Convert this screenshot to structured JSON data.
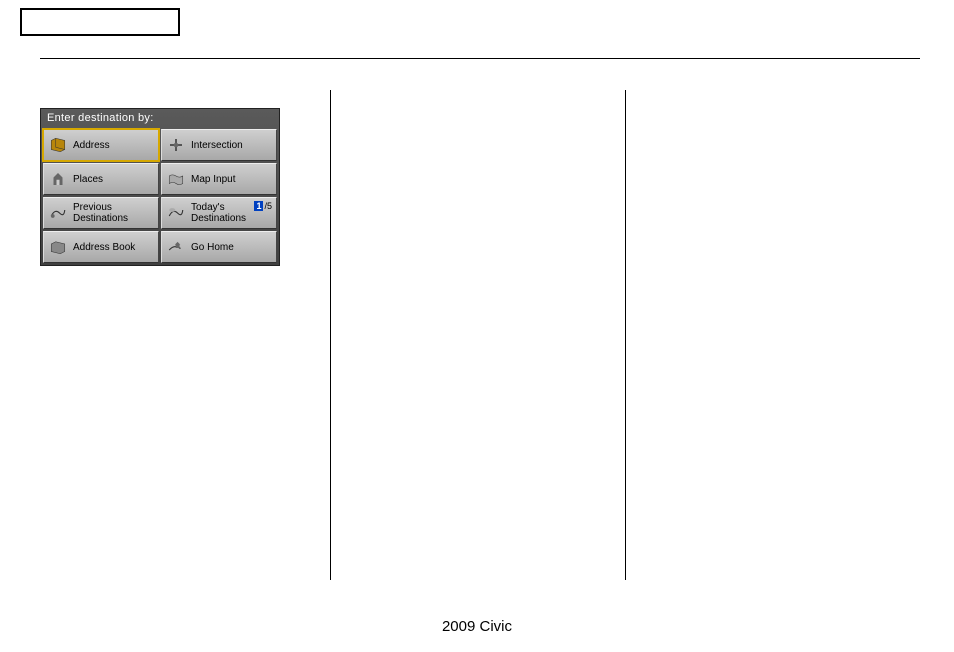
{
  "nav_screen": {
    "header": "Enter destination by:",
    "buttons": [
      {
        "label": "Address",
        "icon": "book-icon",
        "selected": true
      },
      {
        "label": "Intersection",
        "icon": "intersection-icon"
      },
      {
        "label": "Places",
        "icon": "landmark-icon"
      },
      {
        "label": "Map Input",
        "icon": "map-icon"
      },
      {
        "label": "Previous\nDestinations",
        "icon": "car-route-icon"
      },
      {
        "label": "Today's\nDestinations",
        "icon": "cloud-route-icon",
        "counter_cur": "1",
        "counter_total": "/5"
      },
      {
        "label": "Address Book",
        "icon": "address-book-icon"
      },
      {
        "label": "Go Home",
        "icon": "home-icon"
      }
    ]
  },
  "footer": "2009  Civic"
}
